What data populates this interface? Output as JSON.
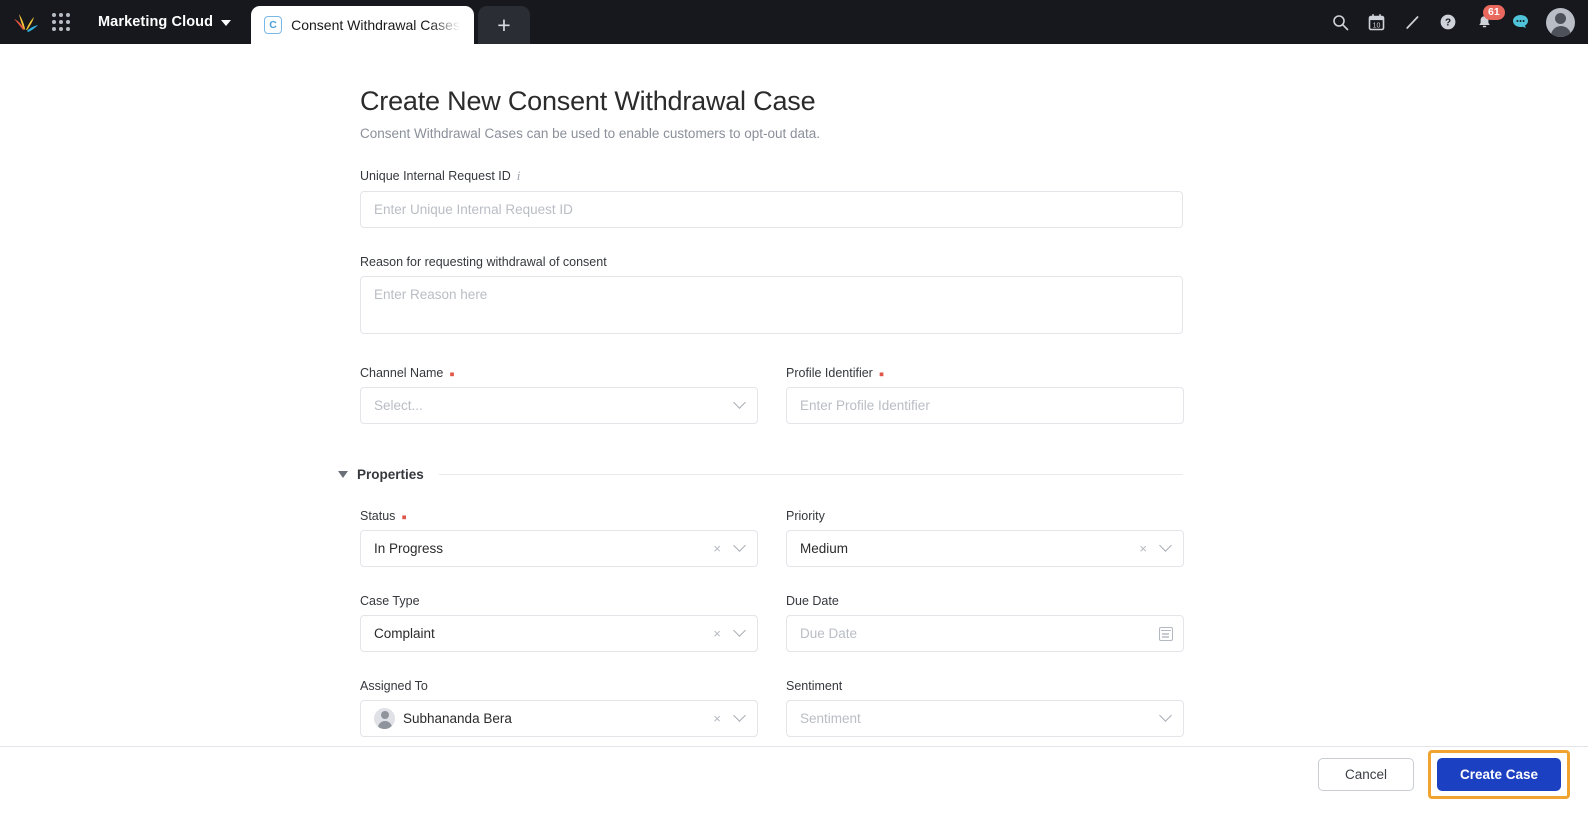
{
  "topnav": {
    "logo_name": "salesforce-marketing-cloud-logo",
    "app_launcher": "app-launcher-grid",
    "cloud_name": "Marketing Cloud",
    "tabs": [
      {
        "icon_letter": "C",
        "label": "Consent Withdrawal Cases",
        "active": true
      }
    ],
    "add_tab_label": "+",
    "icons": [
      {
        "name": "search-icon",
        "glyph": "⌕"
      },
      {
        "name": "calendar-icon",
        "glyph": "10"
      },
      {
        "name": "pencil-icon",
        "glyph": "✎"
      },
      {
        "name": "help-icon",
        "glyph": "?"
      },
      {
        "name": "notifications-bell-icon",
        "badge": "61"
      },
      {
        "name": "chat-icon",
        "glyph": "…"
      }
    ],
    "notification_count": "61",
    "avatar_name": "user-avatar"
  },
  "page": {
    "title": "Create New Consent Withdrawal Case",
    "subtitle": "Consent Withdrawal Cases can be used to enable customers to opt-out data."
  },
  "form": {
    "unique_id": {
      "label": "Unique Internal Request ID",
      "info_glyph": "i",
      "placeholder": "Enter Unique Internal Request ID",
      "value": ""
    },
    "reason": {
      "label": "Reason for requesting withdrawal of consent",
      "placeholder": "Enter Reason here",
      "value": ""
    },
    "channel_name": {
      "label": "Channel Name",
      "required_marker": "▪",
      "placeholder": "Select...",
      "value": ""
    },
    "profile_identifier": {
      "label": "Profile Identifier",
      "required_marker": "▪",
      "placeholder": "Enter Profile Identifier",
      "value": ""
    }
  },
  "properties": {
    "section_label": "Properties",
    "expanded": true,
    "status": {
      "label": "Status",
      "required_marker": "▪",
      "value": "In Progress",
      "clear_glyph": "×"
    },
    "priority": {
      "label": "Priority",
      "value": "Medium",
      "clear_glyph": "×"
    },
    "case_type": {
      "label": "Case Type",
      "value": "Complaint",
      "clear_glyph": "×"
    },
    "due_date": {
      "label": "Due Date",
      "placeholder": "Due Date",
      "value": ""
    },
    "assigned_to": {
      "label": "Assigned To",
      "value": "Subhananda Bera",
      "clear_glyph": "×"
    },
    "sentiment": {
      "label": "Sentiment",
      "placeholder": "Sentiment",
      "value": ""
    }
  },
  "footer": {
    "cancel_label": "Cancel",
    "create_label": "Create Case",
    "highlight_color": "#f0a32e",
    "primary_color": "#1c40c2"
  }
}
